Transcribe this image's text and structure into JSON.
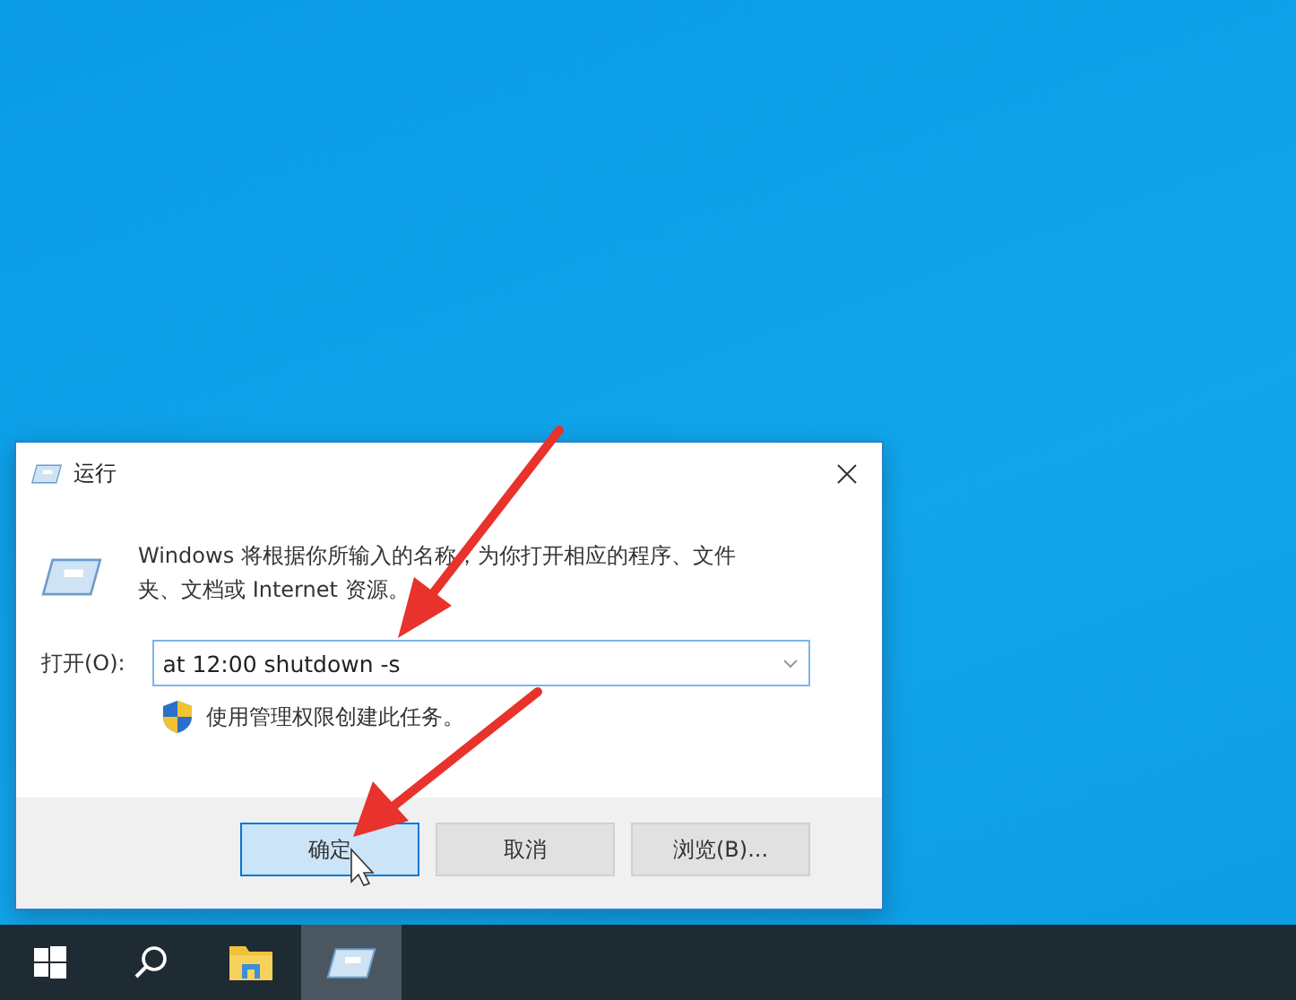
{
  "dialog": {
    "title": "运行",
    "description": "Windows 将根据你所输入的名称，为你打开相应的程序、文件夹、文档或 Internet 资源。",
    "open_label": "打开(O):",
    "command": {
      "value": "at 12:00 shutdown -s"
    },
    "admin_note": "使用管理权限创建此任务。",
    "buttons": [
      {
        "label": "确定",
        "default": true
      },
      {
        "label": "取消",
        "default": false
      },
      {
        "label": "浏览(B)...",
        "default": false
      }
    ]
  },
  "taskbar": {
    "items": [
      {
        "kind": "start",
        "active": false
      },
      {
        "kind": "search",
        "active": false
      },
      {
        "kind": "explorer",
        "active": false
      },
      {
        "kind": "run",
        "active": true
      }
    ]
  }
}
